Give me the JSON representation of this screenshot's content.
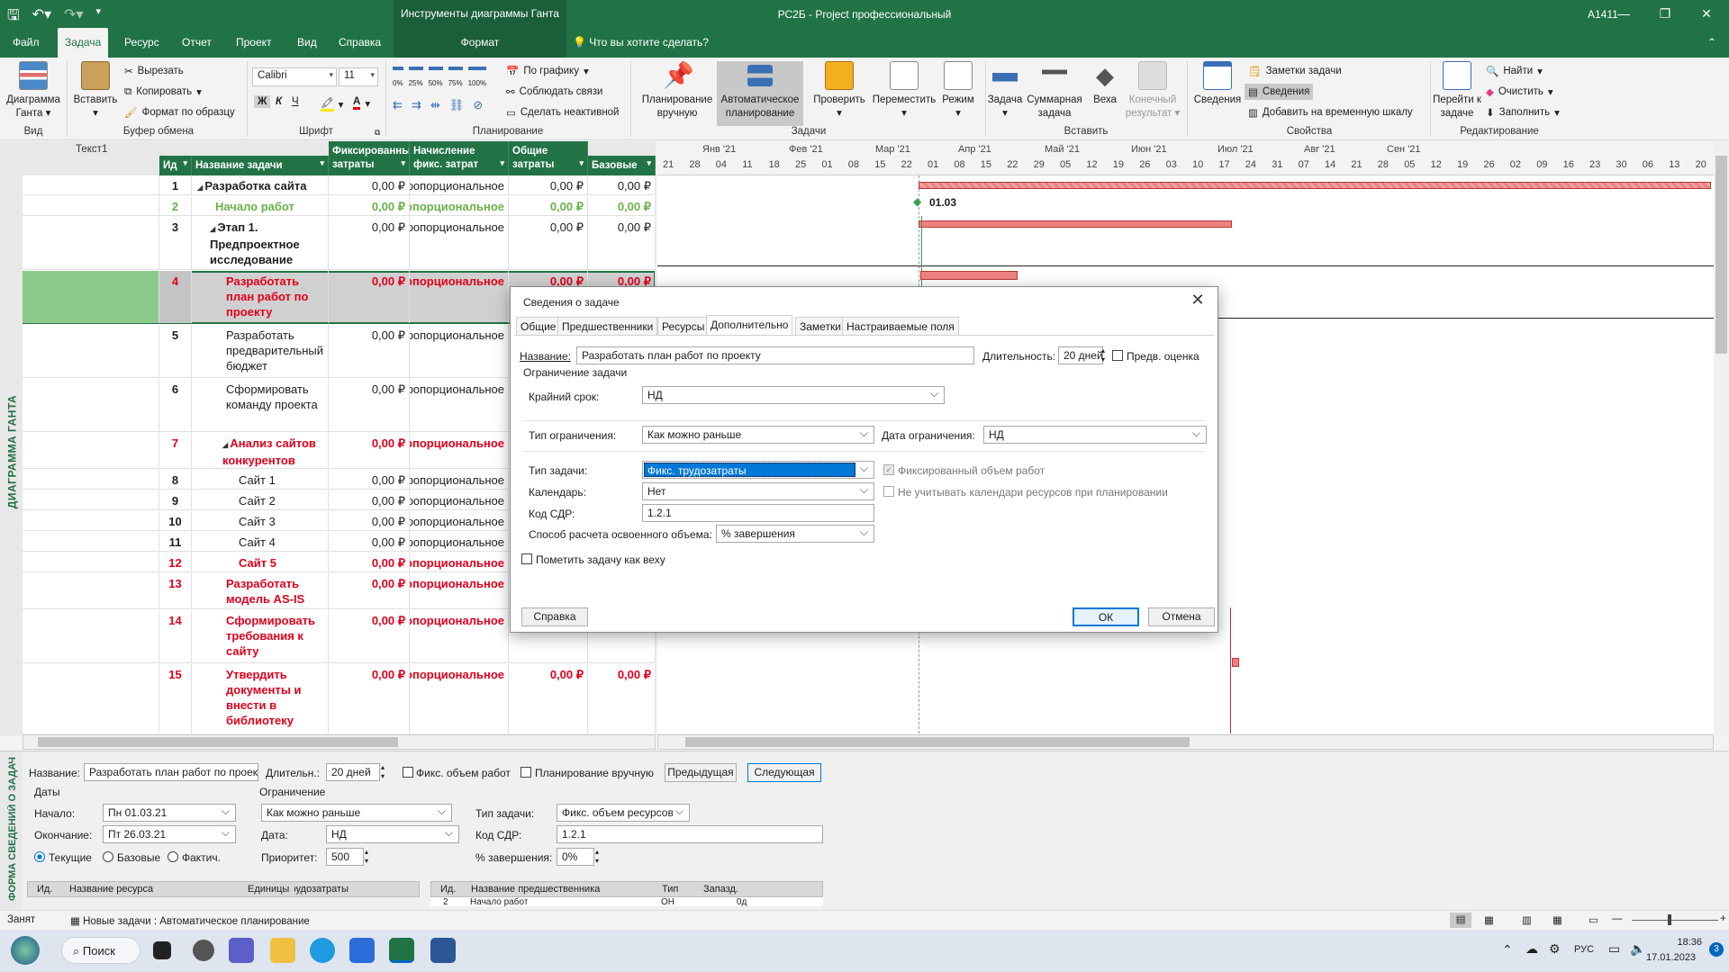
{
  "titlebar": {
    "context_tools": "Инструменты диаграммы Ганта",
    "app_title": "РС2Б  -  Project профессиональный",
    "user": "A1411"
  },
  "tabs": [
    "Файл",
    "Задача",
    "Ресурс",
    "Отчет",
    "Проект",
    "Вид",
    "Справка",
    "Формат"
  ],
  "tell_me": "Что вы хотите сделать?",
  "ribbon": {
    "view": {
      "gantt_btn": "Диаграмма Ганта",
      "group": "Вид"
    },
    "clipboard": {
      "paste": "Вставить",
      "cut": "Вырезать",
      "copy": "Копировать",
      "format_painter": "Формат по образцу",
      "group": "Буфер обмена"
    },
    "font": {
      "family": "Calibri",
      "size": "11",
      "group": "Шрифт",
      "bold": "Ж",
      "italic": "К",
      "underline": "Ч"
    },
    "schedule": {
      "on_track": "По графику",
      "respect_links": "Соблюдать связи",
      "inactivate": "Сделать неактивной",
      "pct": [
        "0%",
        "25%",
        "50%",
        "75%",
        "100%"
      ],
      "group": "Планирование"
    },
    "tasks": {
      "manual": "Планирование вручную",
      "auto": "Автоматическое планирование",
      "inspect": "Проверить",
      "move": "Переместить",
      "mode": "Режим",
      "group": "Задачи"
    },
    "insert": {
      "task": "Задача",
      "summary": "Суммарная задача",
      "milestone": "Веха",
      "deliverable": "Конечный результат",
      "group": "Вставить"
    },
    "properties": {
      "info": "Сведения",
      "notes": "Заметки задачи",
      "details": "Сведения",
      "timeline": "Добавить на временную шкалу",
      "group": "Свойства"
    },
    "editing": {
      "goto": "Перейти к задаче",
      "find": "Найти",
      "clear": "Очистить",
      "fill": "Заполнить",
      "group": "Редактирование"
    }
  },
  "table": {
    "text1_label": "Текст1",
    "columns": [
      "Ид",
      "Название задачи",
      "Фиксированные затраты",
      "Начисление фикс. затрат",
      "Общие затраты",
      "Базовые"
    ],
    "rows": [
      {
        "id": "1",
        "name": "Разработка сайта",
        "fixed": "0,00 ₽",
        "accrual": "Пропорциональное",
        "total": "0,00 ₽",
        "base": "0,00 ₽",
        "style": "summary"
      },
      {
        "id": "2",
        "name": "Начало работ",
        "fixed": "0,00 ₽",
        "accrual": "Пропорциональное",
        "total": "0,00 ₽",
        "base": "0,00 ₽",
        "style": "milestone"
      },
      {
        "id": "3",
        "name": "Этап 1. Предпроектное исследование",
        "fixed": "0,00 ₽",
        "accrual": "Пропорциональное",
        "total": "0,00 ₽",
        "base": "0,00 ₽",
        "style": "summary2"
      },
      {
        "id": "4",
        "name": "Разработать план работ по проекту",
        "fixed": "0,00 ₽",
        "accrual": "Пропорциональное",
        "total": "0,00 ₽",
        "base": "0,00 ₽",
        "style": "selected"
      },
      {
        "id": "5",
        "name": "Разработать предварительный бюджет",
        "fixed": "0,00 ₽",
        "accrual": "Пропорциональное",
        "total": "",
        "base": "",
        "style": "normal"
      },
      {
        "id": "6",
        "name": "Сформировать команду проекта",
        "fixed": "0,00 ₽",
        "accrual": "Пропорциональное",
        "total": "",
        "base": "",
        "style": "normal"
      },
      {
        "id": "7",
        "name": "Анализ сайтов конкурентов",
        "fixed": "0,00 ₽",
        "accrual": "Пропорциональное",
        "total": "",
        "base": "",
        "style": "redsummary"
      },
      {
        "id": "8",
        "name": "Сайт 1",
        "fixed": "0,00 ₽",
        "accrual": "Пропорциональное",
        "total": "",
        "base": "",
        "style": "normal3"
      },
      {
        "id": "9",
        "name": "Сайт 2",
        "fixed": "0,00 ₽",
        "accrual": "Пропорциональное",
        "total": "",
        "base": "",
        "style": "normal3"
      },
      {
        "id": "10",
        "name": "Сайт 3",
        "fixed": "0,00 ₽",
        "accrual": "Пропорциональное",
        "total": "",
        "base": "",
        "style": "normal3"
      },
      {
        "id": "11",
        "name": "Сайт 4",
        "fixed": "0,00 ₽",
        "accrual": "Пропорциональное",
        "total": "",
        "base": "",
        "style": "normal3"
      },
      {
        "id": "12",
        "name": "Сайт 5",
        "fixed": "0,00 ₽",
        "accrual": "Пропорциональное",
        "total": "",
        "base": "",
        "style": "red3"
      },
      {
        "id": "13",
        "name": "Разработать модель AS-IS",
        "fixed": "0,00 ₽",
        "accrual": "Пропорциональное",
        "total": "",
        "base": "",
        "style": "red"
      },
      {
        "id": "14",
        "name": "Сформировать требования к сайту",
        "fixed": "0,00 ₽",
        "accrual": "Пропорциональное",
        "total": "",
        "base": "",
        "style": "red"
      },
      {
        "id": "15",
        "name": "Утвердить документы и внести в библиотеку проекта",
        "fixed": "0,00 ₽",
        "accrual": "Пропорциональное",
        "total": "0,00 ₽",
        "base": "0,00 ₽",
        "style": "red"
      }
    ]
  },
  "vertical_label": "ДИАГРАММА ГАНТА",
  "gantt": {
    "months": [
      "Янв '21",
      "Фев '21",
      "Мар '21",
      "Апр '21",
      "Май '21",
      "Июн '21",
      "Июл '21",
      "Авг '21",
      "Сен '21"
    ],
    "days": [
      "21",
      "28",
      "04",
      "11",
      "18",
      "25",
      "01",
      "08",
      "15",
      "22",
      "01",
      "08",
      "15",
      "22",
      "29",
      "05",
      "12",
      "19",
      "26",
      "03",
      "10",
      "17",
      "24",
      "31",
      "07",
      "14",
      "21",
      "28",
      "05",
      "12",
      "19",
      "26",
      "02",
      "09",
      "16",
      "23",
      "30",
      "06",
      "13",
      "20"
    ],
    "milestone_label": "01.03"
  },
  "dialog": {
    "title": "Сведения о задаче",
    "tabs": [
      "Общие",
      "Предшественники",
      "Ресурсы",
      "Дополнительно",
      "Заметки",
      "Настраиваемые поля"
    ],
    "name_label": "Название:",
    "name_value": "Разработать план работ по проекту",
    "duration_label": "Длительность:",
    "duration_value": "20 дней",
    "estimate_label": "Предв. оценка",
    "constraint_group": "Ограничение задачи",
    "deadline_label": "Крайний срок:",
    "deadline_value": "НД",
    "constraint_type_label": "Тип ограничения:",
    "constraint_type_value": "Как можно раньше",
    "constraint_date_label": "Дата ограничения:",
    "constraint_date_value": "НД",
    "task_type_label": "Тип задачи:",
    "task_type_value": "Фикс. трудозатраты",
    "effort_driven_label": "Фиксированный объем работ",
    "calendar_label": "Календарь:",
    "calendar_value": "Нет",
    "ignore_cal_label": "Не учитывать календари ресурсов при планировании",
    "wbs_label": "Код СДР:",
    "wbs_value": "1.2.1",
    "ev_label": "Способ расчета освоенного объема:",
    "ev_value": "% завершения",
    "mark_milestone_label": "Пометить задачу как веху",
    "help_btn": "Справка",
    "ok_btn": "ОК",
    "cancel_btn": "Отмена"
  },
  "form": {
    "vertical_label": "ФОРМА СВЕДЕНИЙ О ЗАДАЧЕ",
    "name_label": "Название:",
    "name_value": "Разработать план работ по проекту",
    "duration_label": "Длительн.:",
    "duration_value": "20 дней",
    "fixed_work_label": "Фикс. объем работ",
    "manual_label": "Планирование вручную",
    "prev_btn": "Предыдущая",
    "next_btn": "Следующая",
    "dates_group": "Даты",
    "start_label": "Начало:",
    "start_value": "Пн 01.03.21",
    "finish_label": "Окончание:",
    "finish_value": "Пт 26.03.21",
    "current_label": "Текущие",
    "baseline_label": "Базовые",
    "actual_label": "Фактич.",
    "constraint_group": "Ограничение",
    "constraint_value": "Как можно раньше",
    "date_label": "Дата:",
    "date_value": "НД",
    "priority_label": "Приоритет:",
    "priority_value": "500",
    "task_type_label": "Тип задачи:",
    "task_type_value": "Фикс. объем ресурсов",
    "wbs_label": "Код СДР:",
    "wbs_value": "1.2.1",
    "pct_label": "% завершения:",
    "pct_value": "0%",
    "res_cols": [
      "Ид.",
      "Название ресурса",
      "Единицы",
      "Трудозатраты"
    ],
    "pred_cols": [
      "Ид.",
      "Название предшественника",
      "Тип",
      "Запазд."
    ],
    "pred_row": [
      "2",
      "Начало работ",
      "ОН",
      "0д"
    ]
  },
  "status": {
    "busy": "Занят",
    "new_tasks": "Новые задачи : Автоматическое планирование"
  },
  "taskbar": {
    "search": "Поиск",
    "lang": "РУС",
    "time": "18:36",
    "date": "17.01.2023",
    "badge": "3"
  }
}
